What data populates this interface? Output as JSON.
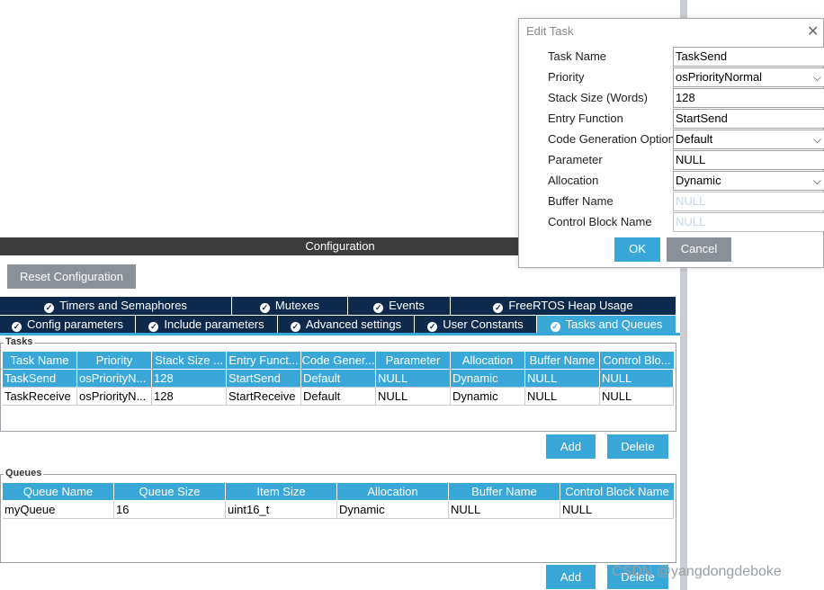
{
  "config_bar": {
    "title": "Configuration"
  },
  "reset_button": "Reset Configuration",
  "tabs_row1": [
    "Timers and Semaphores",
    "Mutexes",
    "Events",
    "FreeRTOS Heap Usage"
  ],
  "tabs_row2": [
    "Config parameters",
    "Include parameters",
    "Advanced settings",
    "User Constants",
    "Tasks and Queues"
  ],
  "tasks": {
    "group_label": "Tasks",
    "columns": [
      "Task Name",
      "Priority",
      "Stack Size ...",
      "Entry Funct...",
      "Code Gener...",
      "Parameter",
      "Allocation",
      "Buffer Name",
      "Control Blo..."
    ],
    "rows": [
      [
        "TaskSend",
        "osPriorityN...",
        "128",
        "StartSend",
        "Default",
        "NULL",
        "Dynamic",
        "NULL",
        "NULL"
      ],
      [
        "TaskReceive",
        "osPriorityN...",
        "128",
        "StartReceive",
        "Default",
        "NULL",
        "Dynamic",
        "NULL",
        "NULL"
      ]
    ],
    "add_label": "Add",
    "delete_label": "Delete"
  },
  "queues": {
    "group_label": "Queues",
    "columns": [
      "Queue Name",
      "Queue Size",
      "Item Size",
      "Allocation",
      "Buffer Name",
      "Control Block Name"
    ],
    "rows": [
      [
        "myQueue",
        "16",
        "uint16_t",
        "Dynamic",
        "NULL",
        "NULL"
      ]
    ],
    "add_label": "Add",
    "delete_label": "Delete"
  },
  "dialog": {
    "title": "Edit Task",
    "fields": [
      {
        "label": "Task Name",
        "value": "TaskSend"
      },
      {
        "label": "Priority",
        "value": "osPriorityNormal"
      },
      {
        "label": "Stack Size (Words)",
        "value": "128"
      },
      {
        "label": "Entry Function",
        "value": "StartSend"
      },
      {
        "label": "Code Generation Option",
        "value": "Default"
      },
      {
        "label": "Parameter",
        "value": "NULL"
      },
      {
        "label": "Allocation",
        "value": "Dynamic"
      },
      {
        "label": "Buffer Name",
        "value": "NULL"
      },
      {
        "label": "Control Block Name",
        "value": "NULL"
      }
    ],
    "ok_label": "OK",
    "cancel_label": "Cancel"
  },
  "watermark": "CSDN @yangdongdeboke",
  "colors": {
    "accent": "#3aa7d9",
    "tab_dark": "#0d2a4d",
    "bar_dark": "#3c3c3c",
    "button_grey": "#8a9098"
  },
  "icons": {
    "tab_check": "check-circle-icon",
    "dialog_close": "close-icon",
    "dropdown": "chevron-down-icon"
  }
}
